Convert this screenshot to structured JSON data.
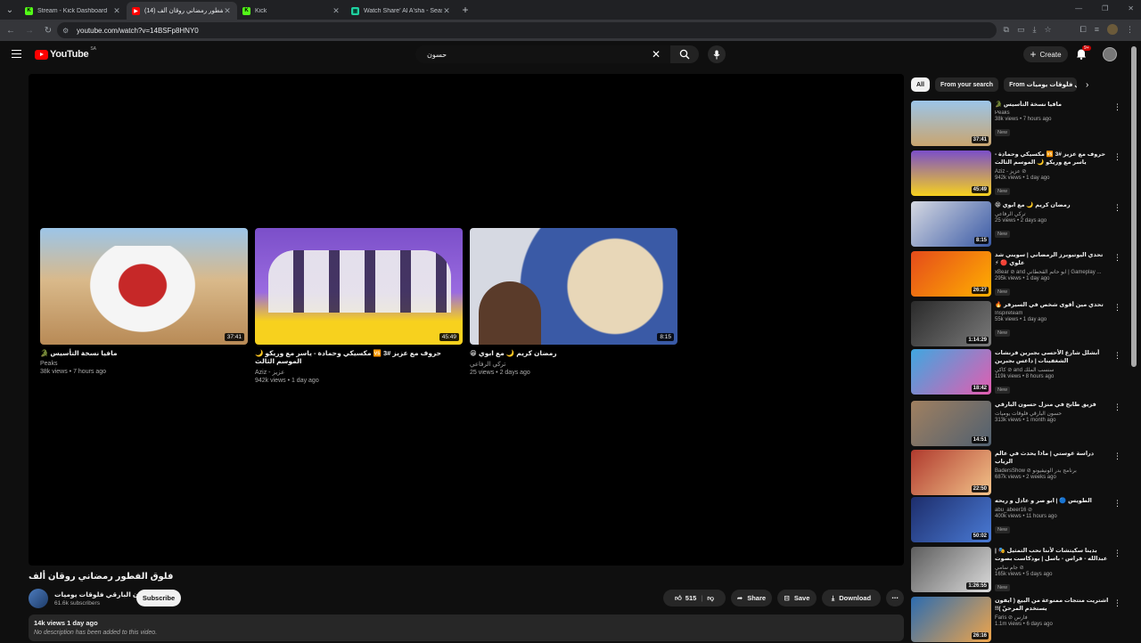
{
  "browser": {
    "tabs": [
      {
        "title": "Stream - Kick Dashboard",
        "active": false,
        "favicon": "kick-icon",
        "color": "#53fc18"
      },
      {
        "title": "(14) فلوق الفطور رمضاني روقان ألف",
        "active": true,
        "favicon": "youtube-icon",
        "color": "#ff0000"
      },
      {
        "title": "Kick",
        "active": false,
        "favicon": "kick-icon",
        "color": "#53fc18"
      },
      {
        "title": "Watch Share' Al A'sha - Season 2",
        "active": false,
        "favicon": "shahid-icon",
        "color": "#1fd1a0"
      }
    ],
    "url": "youtube.com/watch?v=14BSFp8HNY0"
  },
  "header": {
    "logo_text": "YouTube",
    "country_code": "SA",
    "search_query": "حسون",
    "create_label": "Create",
    "notification_count": "9+"
  },
  "endcards": [
    {
      "title": "مافيا نسخة التأسيس 🐊",
      "channel": "Peaks",
      "meta": "38k views • 7 hours ago",
      "duration": "37:41"
    },
    {
      "title": "حروف مع عزيز #3 🆚 مكسيكي وحمادة - ياسر مع وريكو 🌙 الموسم الثالث",
      "channel": "Aziz - عزيز",
      "meta": "942k views • 1 day ago",
      "duration": "45:49"
    },
    {
      "title": "رمضان كريم 🌙 مع ابوي 😁",
      "channel": "تركي الرفاعي",
      "meta": "25 views • 2 days ago",
      "duration": "8:15"
    }
  ],
  "video": {
    "title": "فلوق الفطور رمضاني روقان ألف",
    "channel": "حسون البارقي فلوقات يوميات",
    "subscribers": "61.6k subscribers",
    "subscribe_label": "Subscribe",
    "likes": "515",
    "share_label": "Share",
    "save_label": "Save",
    "download_label": "Download",
    "views_date": "14k views  1 day ago",
    "description": "No description has been added to this video."
  },
  "chips": [
    "All",
    "From your search",
    "From حسون البارقي فلوقات يوميات"
  ],
  "recommendations": [
    {
      "title": "مافيا نسخة التأسيس 🐊",
      "channel": "Peaks",
      "views": "38k views • 7 hours ago",
      "badge": "New",
      "duration": "37:41"
    },
    {
      "title": "حروف مع عزيز #3 🆚 مكسيكي وحمادة - ياسر مع وريكو 🌙 الموسم الثالث",
      "channel": "Aziz - عزيز ⊘",
      "views": "942k views • 1 day ago",
      "badge": "New",
      "duration": "45:49"
    },
    {
      "title": "رمضان كريم 🌙 مع ابوي 😁",
      "channel": "تركي الرفاعي",
      "views": "25 views • 2 days ago",
      "badge": "New",
      "duration": "8:15"
    },
    {
      "title": "تحدي اليوتيوبرز الرمضاني | سويني شد علوي 🔴 ⚡",
      "channel": "xBear ⊘ and ابو حاتم القحطاني | Gameplay ...",
      "views": "295k views • 1 day ago",
      "badge": "New",
      "duration": "26:27"
    },
    {
      "title": "تحدي مين أقوى شخص في السيرفر 🔥",
      "channel": "Inspireteam",
      "views": "55k views • 1 day ago",
      "badge": "New",
      "duration": "1:14:29"
    },
    {
      "title": "أبشلل شارع الأحسى بجبرين فرنشات الشغفينات | داعس بجبرين",
      "channel": "كاكي ⊘ and سنسب الملك",
      "views": "119k views • 8 hours ago",
      "badge": "New",
      "duration": "18:42"
    },
    {
      "title": "فزيق طابخ في منزل حسون البارقي",
      "channel": "حسون البارقي فلوقات يوميات",
      "views": "313k views • 1 month ago",
      "badge": "",
      "duration": "14:51"
    },
    {
      "title": "دراسة غوستي | ماذا يحدث في عالم الرياب",
      "channel": "BadersShow ⊘ برنامج بدر الونيفيونو",
      "views": "687k views • 2 weeks ago",
      "badge": "",
      "duration": "22:50"
    },
    {
      "title": "الطويس 🔵 | ابو صر و عادل و ريحه",
      "channel": "abu_abeer16 ⊘",
      "views": "400k views • 11 hours ago",
      "badge": "New",
      "duration": "50:02"
    },
    {
      "title": "بدينا سكيتشات لأننا نحب التمثيل 🎭 | عبدالله - فراس - باسل | بودكاست بصوت خفي",
      "channel": "جام سامي ⊘",
      "views": "165k views • 5 days ago",
      "badge": "New",
      "duration": "1:26:55"
    },
    {
      "title": "اشتريت منتجات ممنوعة من البيع ( ايفون يستخدم المرحنّ )!!",
      "channel": "Faris ⊘ فارس",
      "views": "1.1m views • 6 days ago",
      "badge": "",
      "duration": "26:16"
    }
  ]
}
